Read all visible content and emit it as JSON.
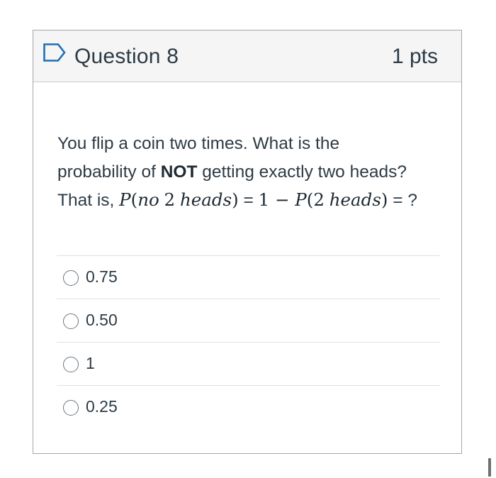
{
  "question": {
    "title": "Question 8",
    "points": "1 pts",
    "text": {
      "line1": "You flip a coin two times. What is the",
      "line2_before": "probability of ",
      "line2_bold": "NOT",
      "line2_after": " getting exactly two heads?",
      "line3_prefix": "That is, ",
      "formula": {
        "p1": "P",
        "open1": "(",
        "no": "no",
        "two1": "2",
        "heads1": "heads",
        "close1": ")",
        "equals1": " = ",
        "one": "1",
        "minus": " − ",
        "p2": "P",
        "open2": "(",
        "two2": "2",
        "heads2": "heads",
        "close2": ")",
        "equals2": " = ",
        "question_mark": "?"
      }
    },
    "answers": [
      {
        "label": "0.75"
      },
      {
        "label": "0.50"
      },
      {
        "label": "1"
      },
      {
        "label": "0.25"
      }
    ]
  },
  "colors": {
    "header_background": "#f5f5f5",
    "border": "#a6a6a6",
    "flag_icon": "#1f6fb5",
    "text": "#2d3b45"
  },
  "icons": {
    "header": "bookmark-flag-icon",
    "answer": "radio-circle-icon"
  }
}
